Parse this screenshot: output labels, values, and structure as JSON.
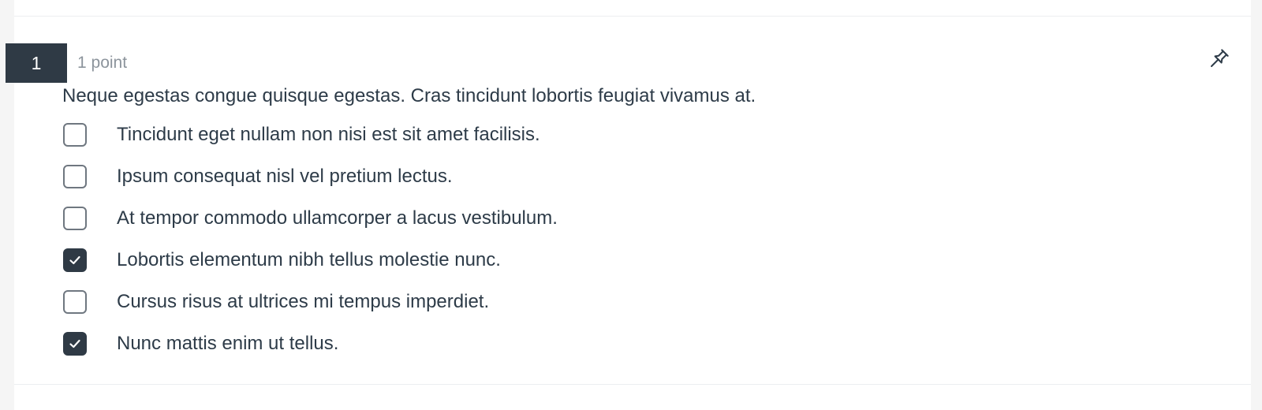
{
  "question": {
    "number": "1",
    "points": "1 point",
    "text": "Neque egestas congue quisque egestas. Cras tincidunt lobortis feugiat vivamus at.",
    "pin_icon": "pin-icon",
    "options": [
      {
        "label": "Tincidunt eget nullam non nisi est sit amet facilisis.",
        "checked": false
      },
      {
        "label": "Ipsum consequat nisl vel pretium lectus.",
        "checked": false
      },
      {
        "label": "At tempor commodo ullamcorper a lacus vestibulum.",
        "checked": false
      },
      {
        "label": "Lobortis elementum nibh tellus molestie nunc.",
        "checked": true
      },
      {
        "label": "Cursus risus at ultrices mi tempus imperdiet.",
        "checked": false
      },
      {
        "label": "Nunc mattis enim ut tellus.",
        "checked": true
      }
    ]
  },
  "colors": {
    "accent": "#2f3a45",
    "text": "#2d3b48",
    "muted": "#8c949c",
    "checkbox_border": "#6f7780"
  }
}
